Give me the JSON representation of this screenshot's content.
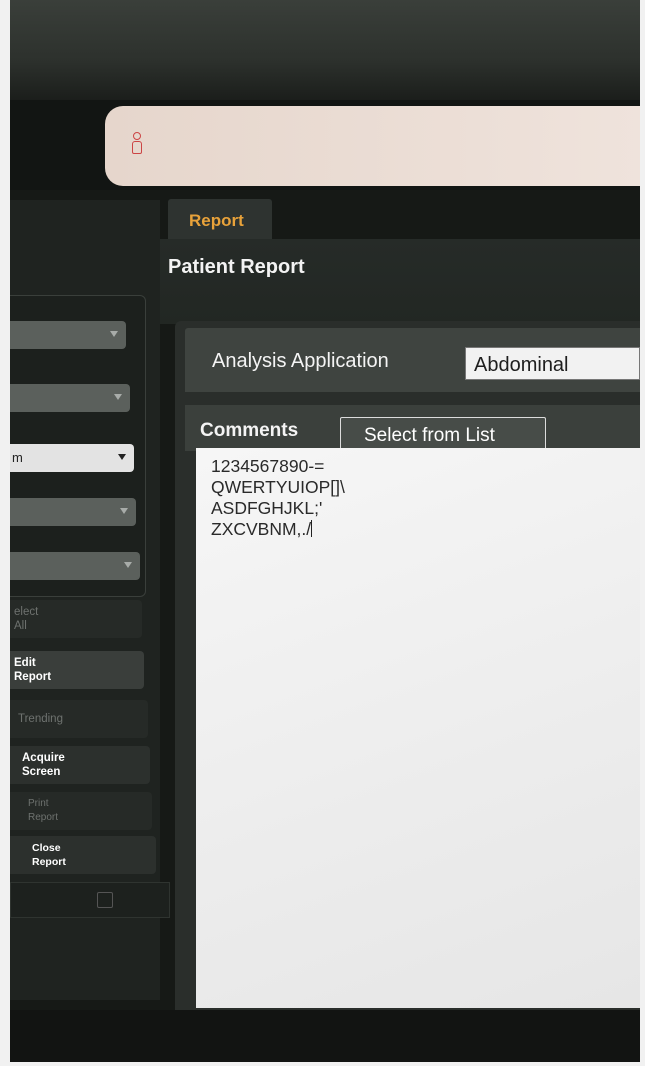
{
  "header": {
    "patient_icon": "person-icon"
  },
  "sidebar": {
    "dropdowns": [
      {
        "value": ""
      },
      {
        "value": ""
      },
      {
        "value": "m"
      },
      {
        "value": ""
      },
      {
        "value": ""
      }
    ],
    "buttons": {
      "select_all": "elect\nAll",
      "edit_report": "Edit\nReport",
      "trending": "Trending",
      "acquire_screen": "Acquire\nScreen",
      "print_report": "Print\nReport",
      "close_report": "Close\nReport"
    },
    "bottom_icon": "square-icon"
  },
  "main": {
    "tab_label": "Report",
    "title": "Patient Report",
    "analysis_application": {
      "label": "Analysis Application",
      "value": "Abdominal"
    },
    "comments": {
      "label": "Comments",
      "select_button": "Select from List",
      "lines": [
        "1234567890-=",
        "QWERTYUIOP[]\\",
        "ASDFGHJKL;'",
        "ZXCVBNM,./"
      ]
    }
  },
  "colors": {
    "accent_tab": "#e8a23a",
    "panel_dark": "#1f2320",
    "text_area": "#f2f2f2"
  }
}
